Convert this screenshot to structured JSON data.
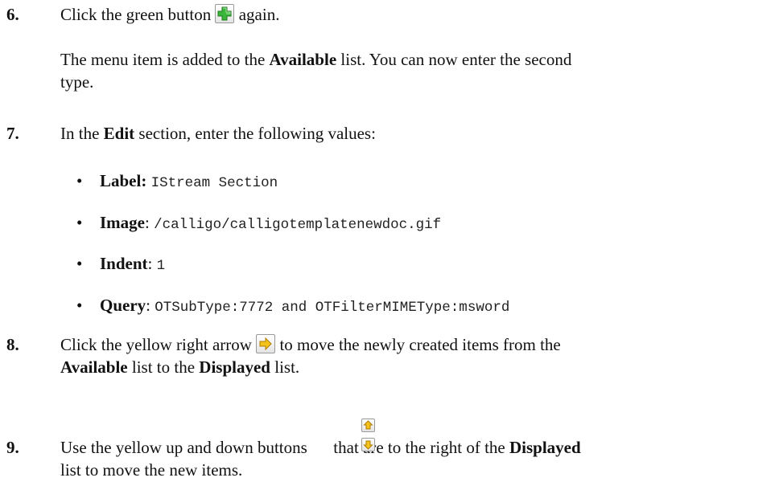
{
  "steps": [
    {
      "number": "6.",
      "line1_before": "Click the green button",
      "line1_after": "again.",
      "note_line1_a": "The menu item is added to the ",
      "note_line1_bold": "Available",
      "note_line1_b": " list. You can now enter the second",
      "note_line2": "type."
    },
    {
      "number": "7.",
      "text_a": "In the ",
      "text_bold": "Edit",
      "text_b": " section, enter the following values:",
      "bullets": [
        {
          "label": "Label:",
          "sep": " ",
          "value": "IStream Section"
        },
        {
          "label": "Image",
          "sep": ": ",
          "value": "/calligo/calligotemplatenewdoc.gif"
        },
        {
          "label": "Indent",
          "sep": ": ",
          "value": "1"
        },
        {
          "label": "Query",
          "sep": ": ",
          "value": "OTSubType:7772 and OTFilterMIMEType:msword"
        }
      ]
    },
    {
      "number": "8.",
      "line1_before": "Click the yellow right arrow",
      "line1_after": "to move the newly created items from the",
      "line2_bold1": "Available",
      "line2_mid": " list to the ",
      "line2_bold2": "Displayed",
      "line2_end": " list."
    },
    {
      "number": "9.",
      "line1_before": "Use the yellow up and down buttons",
      "line1_mid": "that are to the right of the ",
      "line1_bold": "Displayed",
      "line2": "list to move the new items."
    }
  ],
  "icons": {
    "green_add": "green-plus-icon",
    "right_arrow": "yellow-right-arrow-icon",
    "up_arrow": "yellow-up-arrow-icon",
    "down_arrow": "yellow-down-arrow-icon"
  },
  "colors": {
    "green": "#2fae2f",
    "yellow": "#f3c21b"
  }
}
